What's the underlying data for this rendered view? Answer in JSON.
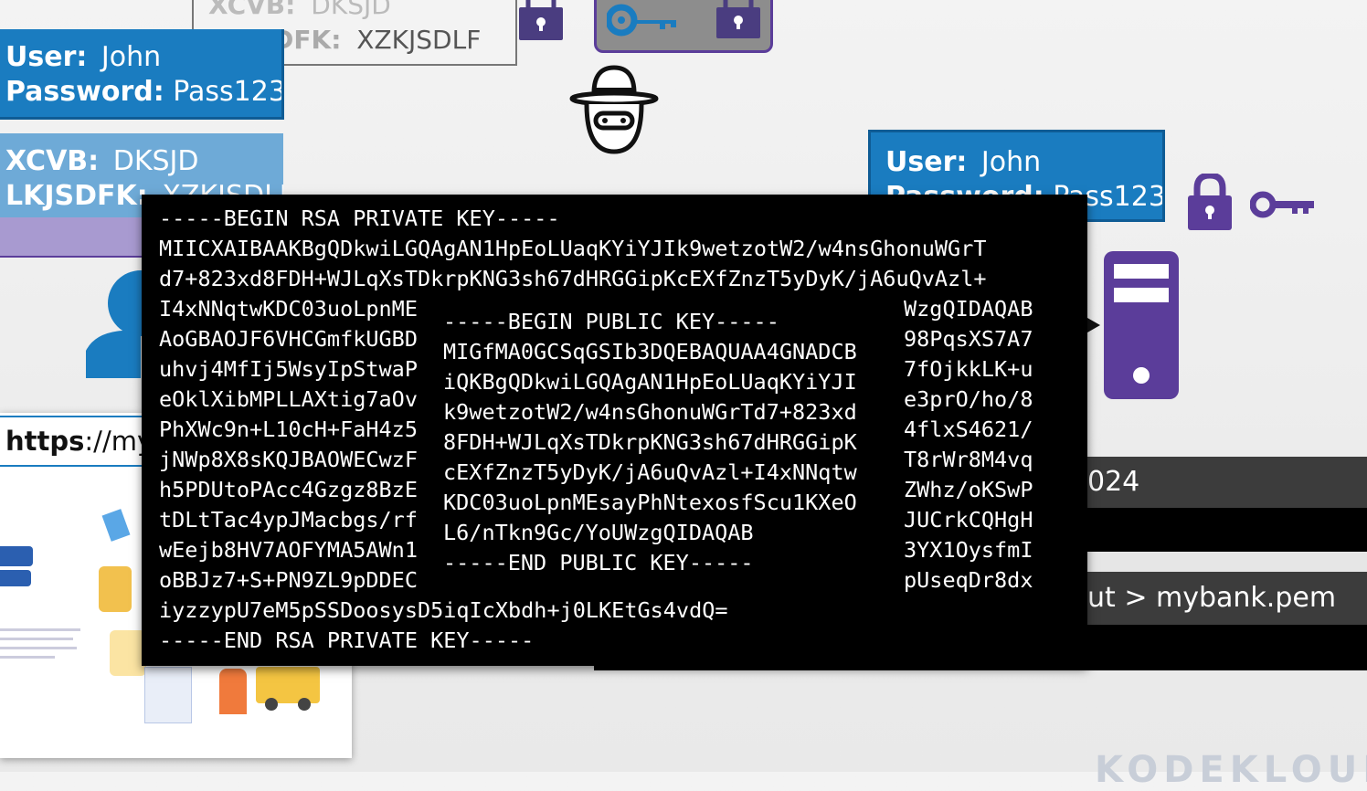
{
  "top_scrambled_box": {
    "line1_key": "XCVB:",
    "line1_val": "DKSJD",
    "line2_key": "LKJSDFK:",
    "line2_val": "XZKJSDLF"
  },
  "left_cred_box": {
    "user_key": "User:",
    "user_val": "John",
    "pass_key": "Password:",
    "pass_val": "Pass123"
  },
  "left_scrambled_box": {
    "line1_key": "XCVB:",
    "line1_val": "DKSJD",
    "line2_key": "LKJSDFK:",
    "line2_val": "XZKJSDLF"
  },
  "right_cred_box": {
    "user_key": "User:",
    "user_val": "John",
    "pass_key": "Password:",
    "pass_val": "Pass123"
  },
  "browser_url": {
    "scheme": "https",
    "rest": "://my"
  },
  "right_terminal": {
    "line1": "024",
    "line2": "ut > mybank.pem"
  },
  "private_key_terminal": {
    "header": "-----BEGIN RSA PRIVATE KEY-----",
    "full_lines": [
      "MIICXAIBAAKBgQDkwiLGQAgAN1HpEoLUaqKYiYJIk9wetzotW2/w4nsGhonuWGrT",
      "d7+823xd8FDH+WJLqXsTDkrpKNG3sh67dHRGGipKcEXfZnzT5yDyK/jA6uQvAzl+"
    ],
    "split_lines": [
      {
        "left": "I4xNNqtwKDC03uoLpnME",
        "right": "WzgQIDAQAB"
      },
      {
        "left": "AoGBAOJF6VHCGmfkUGBD",
        "right": "98PqsXS7A7"
      },
      {
        "left": "uhvj4MfIj5WsyIpStwaP",
        "right": "7fOjkkLK+u"
      },
      {
        "left": "eOklXibMPLLAXtig7aOv",
        "right": "e3prO/ho/8"
      },
      {
        "left": "PhXWc9n+L10cH+FaH4z5",
        "right": "4flxS4621/"
      },
      {
        "left": "jNWp8X8sKQJBAOWECwzF",
        "right": "T8rWr8M4vq"
      },
      {
        "left": "h5PDUtoPAcc4Gzgz8BzE",
        "right": "ZWhz/oKSwP"
      },
      {
        "left": "tDLtTac4ypJMacbgs/rf",
        "right": "JUCrkCQHgH"
      },
      {
        "left": "wEejb8HV7AOFYMA5AWn1",
        "right": "3YX1OysfmI"
      },
      {
        "left": "oBBJz7+S+PN9ZL9pDDEC",
        "right": "pUseqDr8dx"
      }
    ],
    "tail_line": "iyzzypU7eM5pSSDoosysD5iqIcXbdh+j0LKEtGs4vdQ=",
    "footer": "-----END RSA PRIVATE KEY-----"
  },
  "public_key_box": {
    "header": "-----BEGIN PUBLIC KEY-----",
    "lines": [
      "MIGfMA0GCSqGSIb3DQEBAQUAA4GNADCB",
      "iQKBgQDkwiLGQAgAN1HpEoLUaqKYiYJI",
      "k9wetzotW2/w4nsGhonuWGrTd7+823xd",
      "8FDH+WJLqXsTDkrpKNG3sh67dHRGGipK",
      "cEXfZnzT5yDyK/jA6uQvAzl+I4xNNqtw",
      "KDC03uoLpnMEsayPhNtexosfScu1KXeO",
      "L6/nTkn9Gc/YoUWzgQIDAQAB"
    ],
    "footer": "-----END PUBLIC KEY-----"
  },
  "icons": {
    "hacker": "hacker-icon",
    "lock_small_1": "padlock-icon",
    "key_box": "key-icon",
    "lock_small_2": "padlock-icon",
    "server_lock": "padlock-icon",
    "server_key": "key-icon",
    "server": "server-icon",
    "user": "user-icon"
  },
  "colors": {
    "cred_blue": "#1a7cc0",
    "cred_light_blue": "#6eaad7",
    "purple": "#5b3d9a",
    "terminal_bg": "#000000",
    "gray_box": "#8d8d8d"
  },
  "watermark": "KODEKLOUD"
}
